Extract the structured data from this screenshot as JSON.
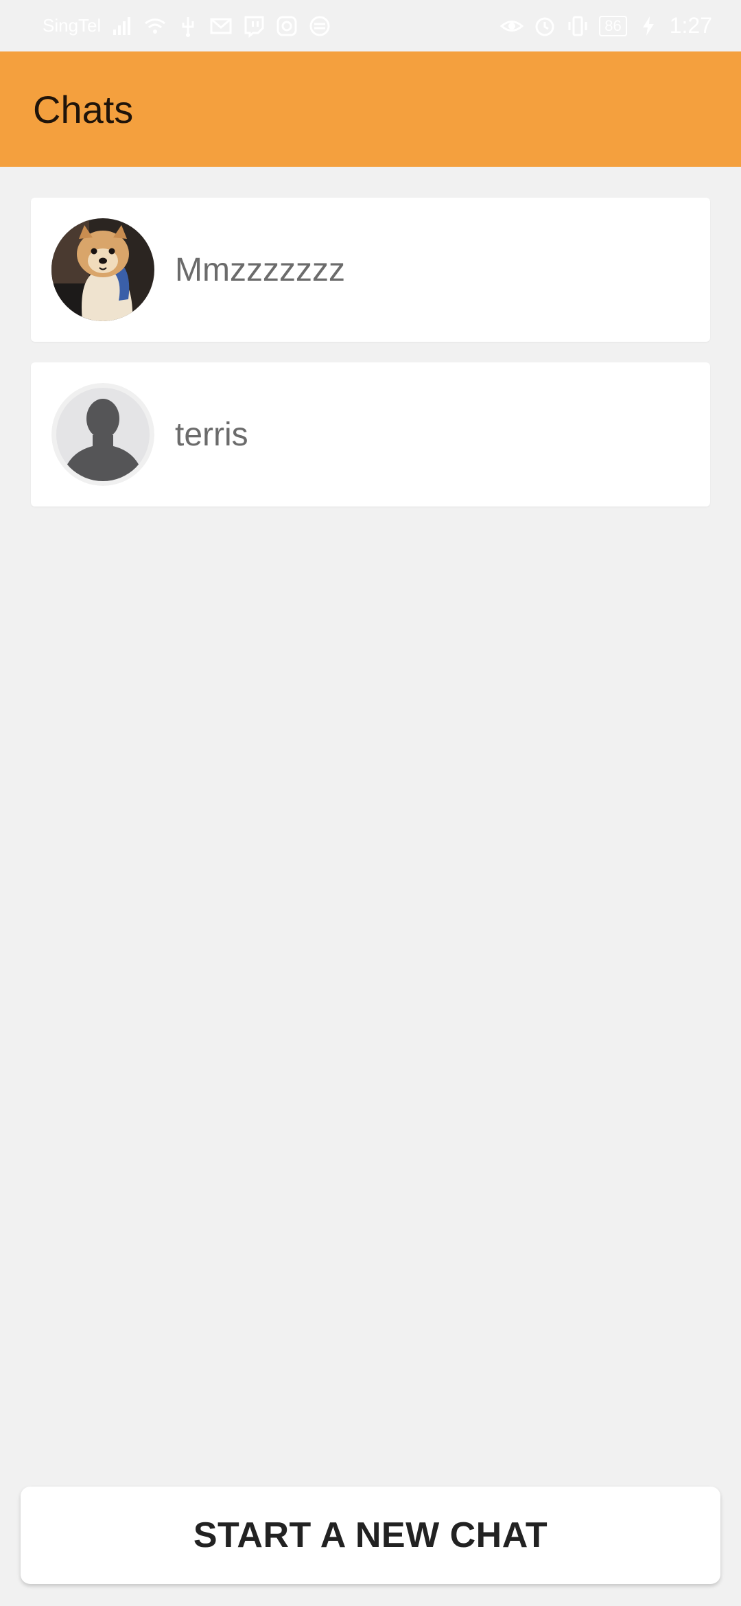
{
  "status_bar": {
    "carrier": "SingTel",
    "battery": "86",
    "time": "1:27",
    "left_icons": [
      "signal-icon",
      "wifi-icon",
      "usb-icon",
      "mail-icon",
      "twitch-icon",
      "app-icon",
      "sync-icon"
    ],
    "right_icons": [
      "eye-icon",
      "alarm-icon",
      "vibrate-icon",
      "battery-icon",
      "charging-icon"
    ]
  },
  "app_bar": {
    "title": "Chats",
    "color": "#f4a03e"
  },
  "chats": [
    {
      "name": "Mmzzzzzzz",
      "avatar": "dog-photo-avatar"
    },
    {
      "name": "terris",
      "avatar": "default-person-avatar"
    }
  ],
  "actions": {
    "start_chat_label": "START A NEW CHAT"
  }
}
